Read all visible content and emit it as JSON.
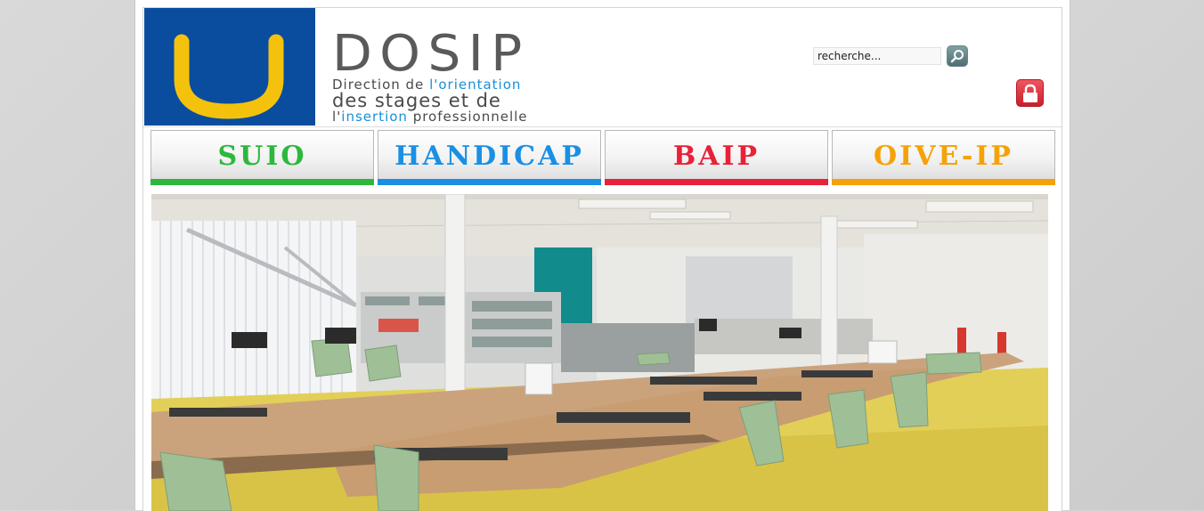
{
  "header": {
    "logo_letter": "U",
    "brand_title": "DOSIP",
    "brand_line1_prefix": "Direction de ",
    "brand_line1_accent": "l'orientation",
    "brand_line2": "des stages et de",
    "brand_line3_prefix": "l'",
    "brand_line3_accent": "insertion",
    "brand_line3_suffix": " professionnelle",
    "colors": {
      "logo_bg": "#0a4d9e",
      "logo_letter": "#f4c20d",
      "accent": "#1a8fd8"
    }
  },
  "search": {
    "placeholder": "recherche...",
    "value": "recherche...",
    "button_icon": "search-icon"
  },
  "lock": {
    "icon": "lock-icon",
    "color": "#d6262f"
  },
  "nav": {
    "tabs": [
      {
        "label": "SUIO",
        "color": "#2db83d"
      },
      {
        "label": "HANDICAP",
        "color": "#1a8fe3"
      },
      {
        "label": "BAIP",
        "color": "#e8213a"
      },
      {
        "label": "OIVE-IP",
        "color": "#f5a20a"
      }
    ]
  },
  "banner": {
    "description_icon": "office-room-photo"
  }
}
